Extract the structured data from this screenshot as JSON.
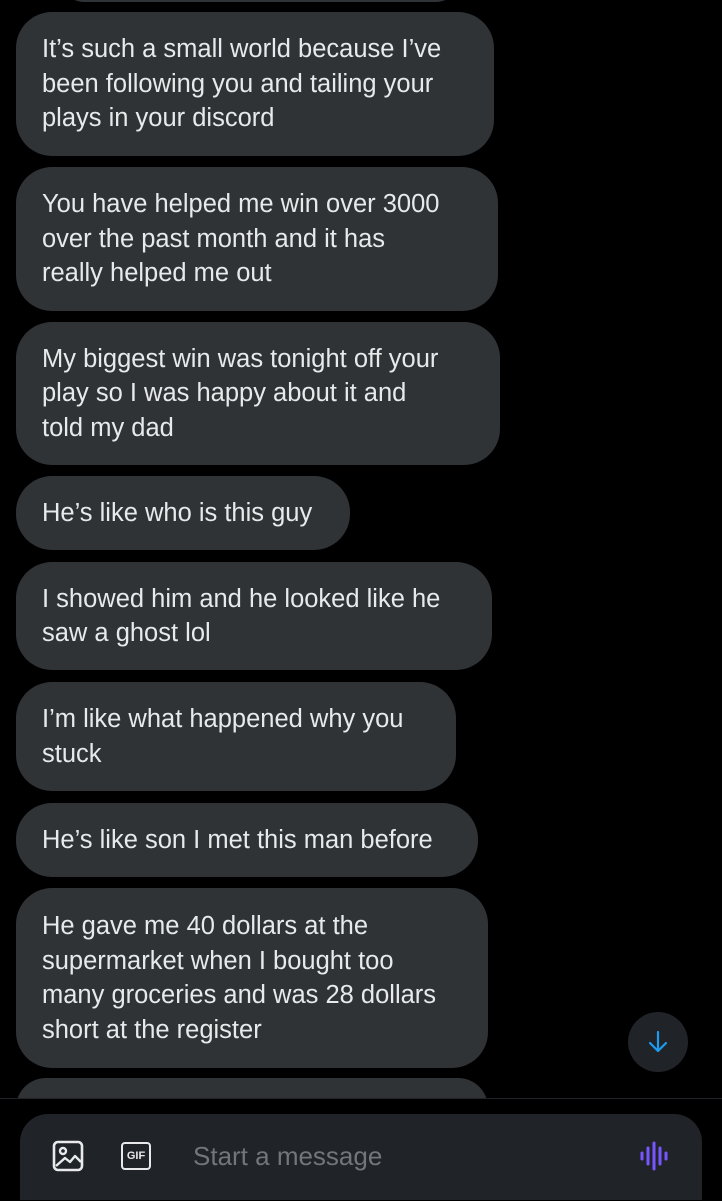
{
  "messages": [
    {
      "text": "It’s such a small world because I’ve\nbeen following you and tailing your\nplays in your discord"
    },
    {
      "text": "You have helped me win over 3000\nover the past month and it has\nreally helped me out"
    },
    {
      "text": "My biggest win was tonight off your\nplay so I was happy about it and\ntold my dad"
    },
    {
      "text": "He’s like who is this guy"
    },
    {
      "text": "I showed him and he looked like he\nsaw a ghost lol"
    },
    {
      "text": "I’m like what happened why you\nstuck"
    },
    {
      "text": "He’s like son I met this man before"
    },
    {
      "text": "He gave me 40 dollars at the\nsupermarket when I bought too\nmany groceries and was 28 dollars\nshort at the register"
    }
  ],
  "composer": {
    "placeholder": "Start a message",
    "gif_label": "GIF",
    "media_icon": "image-icon",
    "voice_icon": "voice-waveform-icon"
  },
  "scroll_button": {
    "icon": "arrow-down-icon"
  },
  "colors": {
    "background": "#000000",
    "bubble": "#2f3336",
    "text": "#e7e9ea",
    "placeholder": "#71767b",
    "accent_blue": "#1d9bf0",
    "accent_purple": "#7856ff"
  }
}
